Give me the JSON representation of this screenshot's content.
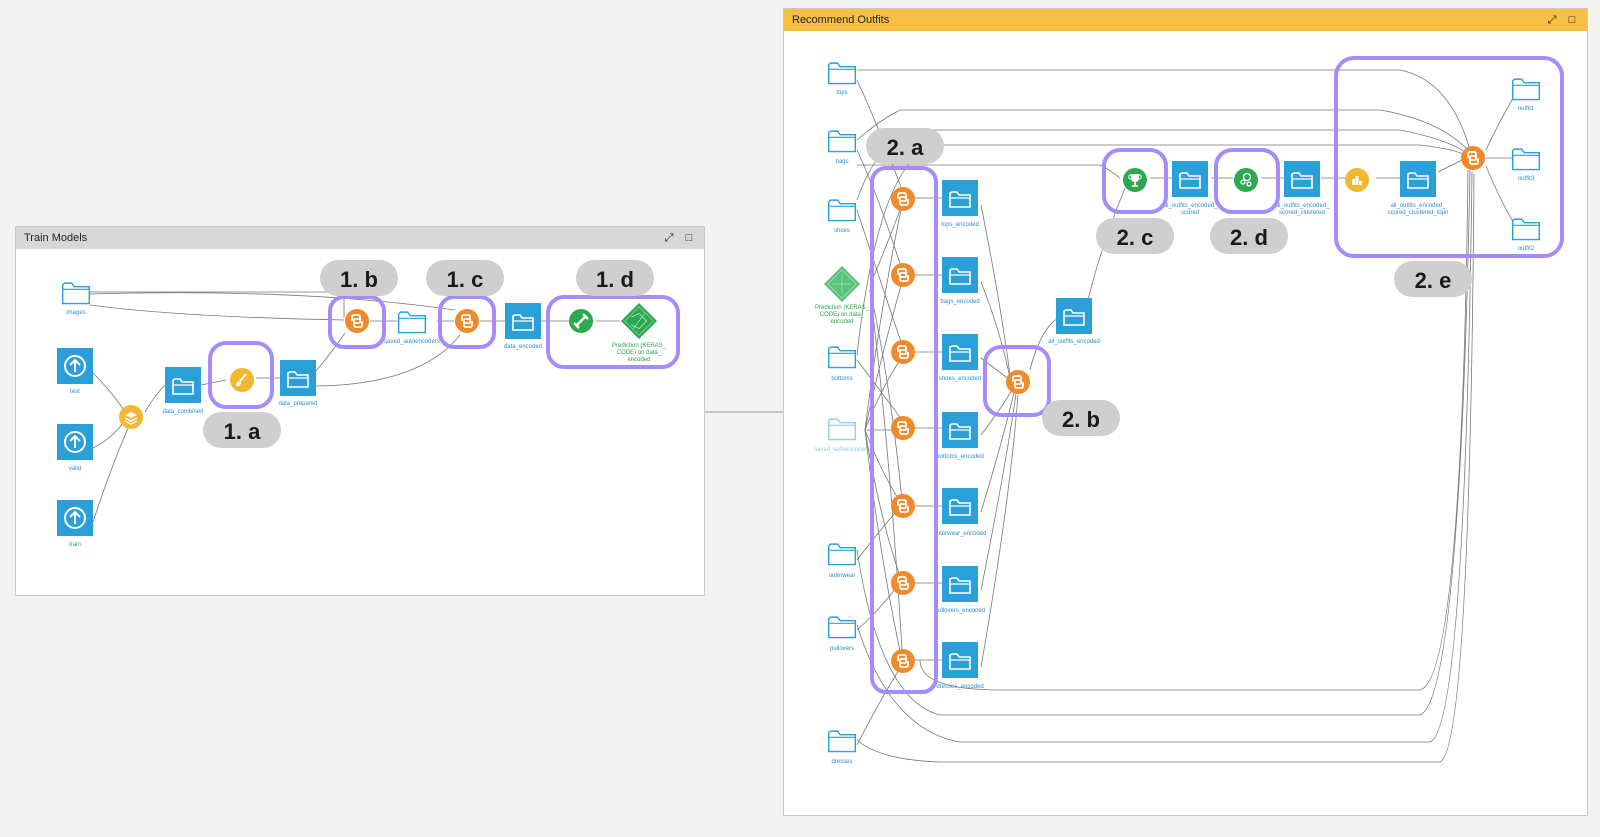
{
  "zones": {
    "train": {
      "title": "Train Models"
    },
    "recommend": {
      "title": "Recommend Outfits"
    }
  },
  "icons": {
    "collapse": "collapse-icon",
    "maximize": "maximize-icon"
  },
  "colors": {
    "dataset_blue": "#2a9fd8",
    "python_orange": "#f08a2a",
    "recipe_yellow": "#f5b731",
    "model_green": "#2ea84f",
    "highlight_purple": "#a78bfa",
    "tag_gray": "#cfcfcf"
  },
  "labels": {
    "images": "images",
    "test": "test",
    "valid": "valid",
    "train": "train",
    "data_combined": "data_combined",
    "data_prepared": "data_prepared",
    "saved_autoencoders": "saved_autoencoders",
    "data_encoded": "data_encoded",
    "prediction_train_1": "Prediction (KERAS_",
    "prediction_train_2": "CODE) on data_",
    "prediction_train_3": "encoded",
    "tops": "tops",
    "bags": "bags",
    "shoes": "shoes",
    "prediction_rec_1": "Prediction (KERAS_",
    "prediction_rec_2": "CODE) on data_",
    "prediction_rec_3": "encoded",
    "bottoms": "bottoms",
    "saved_autoencoders_rec": "saved_autoencoders",
    "outerwear": "outerwear",
    "pullovers": "pullovers",
    "dresses": "dresses",
    "tops_encoded": "tops_encoded",
    "bags_encoded": "bags_encoded",
    "shoes_encoded": "shoes_encoded",
    "bottoms_encoded": "bottoms_encoded",
    "outerwear_encoded": "outerwear_encoded",
    "pullovers_encoded": "pullovers_encoded",
    "dresses_encoded": "dresses_encoded",
    "all_outfits_encoded": "all_outfits_encoded",
    "scored_1": "all_outfits_encoded_",
    "scored_2": "scored",
    "clustered_1": "all_outfits_encoded_",
    "clustered_2": "scored_clustered",
    "topn_1": "all_outfits_encoded_",
    "topn_2": "scored_clustered_topn",
    "outfit1": "outfit1",
    "outfit3": "outfit3",
    "outfit2": "outfit2"
  },
  "tags": {
    "t1a": "1. a",
    "t1b": "1. b",
    "t1c": "1. c",
    "t1d": "1. d",
    "t2a": "2. a",
    "t2b": "2. b",
    "t2c": "2. c",
    "t2d": "2. d",
    "t2e": "2. e"
  }
}
